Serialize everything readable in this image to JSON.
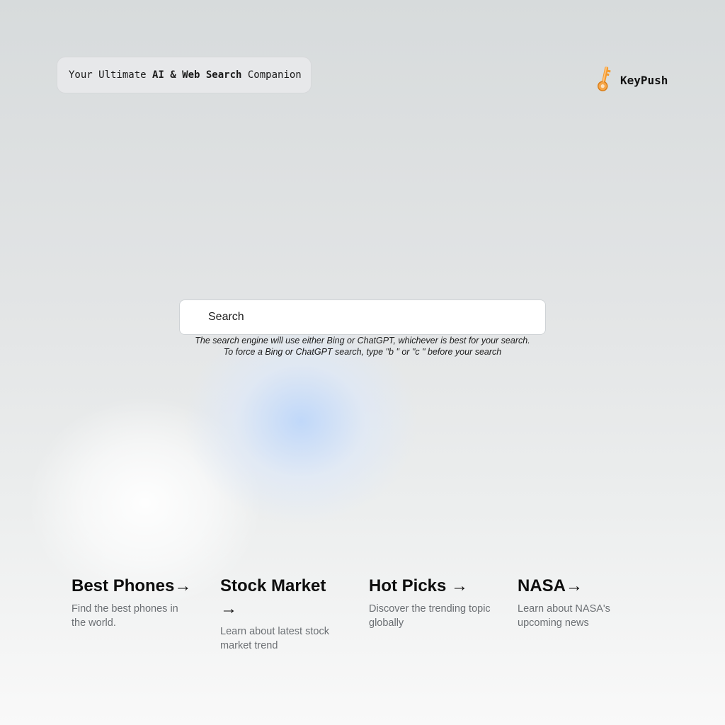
{
  "header": {
    "tagline_prefix": "Your Ultimate ",
    "tagline_bold": "AI & Web Search",
    "tagline_suffix": " Companion"
  },
  "brand": {
    "name": "KeyPush",
    "icon": "key-icon",
    "icon_color": "#f39a2e"
  },
  "search": {
    "placeholder": "Search",
    "value": "",
    "hint_line1": "The search engine will use either Bing or ChatGPT, whichever is best for your search.",
    "hint_line2": "To force a Bing or ChatGPT search, type \"b \" or \"c \" before your search"
  },
  "cards": [
    {
      "title": "Best Phones",
      "arrow": "→",
      "description": "Find the best phones in the world."
    },
    {
      "title": "Stock Market",
      "arrow": "→",
      "description": "Learn about latest stock market trend"
    },
    {
      "title": "Hot Picks",
      "arrow": "→",
      "description": "Discover the trending topic globally"
    },
    {
      "title": "NASA",
      "arrow": "→",
      "description": "Learn about NASA's upcoming news"
    }
  ],
  "colors": {
    "accent_glow": "#cfe0fa",
    "text_primary": "#111111",
    "text_muted": "#6b6f73"
  }
}
